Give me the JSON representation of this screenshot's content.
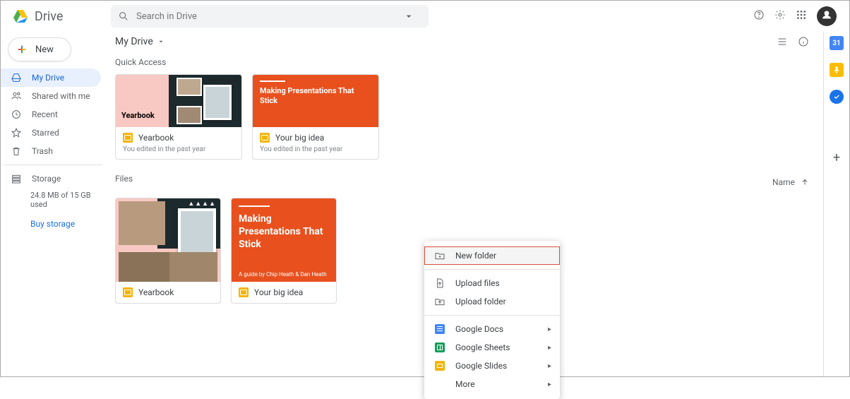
{
  "app": {
    "name": "Drive"
  },
  "search": {
    "placeholder": "Search in Drive"
  },
  "new_button": "New",
  "sidebar": {
    "items": [
      {
        "label": "My Drive",
        "active": true
      },
      {
        "label": "Shared with me"
      },
      {
        "label": "Recent"
      },
      {
        "label": "Starred"
      },
      {
        "label": "Trash"
      }
    ],
    "storage_label": "Storage",
    "storage_used": "24.8 MB of 15 GB used",
    "buy": "Buy storage"
  },
  "breadcrumb": "My Drive",
  "quick_access": {
    "label": "Quick Access",
    "cards": [
      {
        "title": "Yearbook",
        "subtitle": "You edited in the past year",
        "thumb_label": "Yearbook"
      },
      {
        "title": "Your big idea",
        "subtitle": "You edited in the past year",
        "thumb_title": "Making Presentations That Stick"
      }
    ]
  },
  "files": {
    "label": "Files",
    "sort_label": "Name",
    "items": [
      {
        "title": "Yearbook"
      },
      {
        "title": "Your big idea",
        "thumb_title": "Making Presentations That Stick",
        "thumb_sub": "A guide by Chip Heath & Dan Heath"
      }
    ]
  },
  "context_menu": {
    "new_folder": "New folder",
    "upload_files": "Upload files",
    "upload_folder": "Upload folder",
    "google_docs": "Google Docs",
    "google_sheets": "Google Sheets",
    "google_slides": "Google Slides",
    "more": "More"
  },
  "rail": {
    "cal": "31"
  }
}
